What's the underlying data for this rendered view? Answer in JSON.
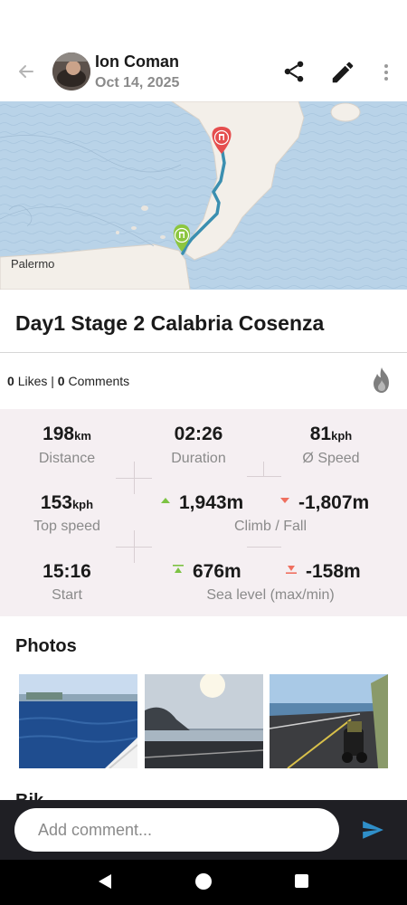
{
  "header": {
    "user_name": "Ion Coman",
    "date": "Oct 14, 2025"
  },
  "map": {
    "city_label": "Palermo"
  },
  "trip": {
    "title": "Day1 Stage 2 Calabria Cosenza"
  },
  "social": {
    "likes_count": "0",
    "likes_label": "Likes |",
    "comments_count": "0",
    "comments_label": "Comments"
  },
  "stats": {
    "distance": {
      "value": "198",
      "unit": "km",
      "label": "Distance"
    },
    "duration": {
      "value": "02:26",
      "label": "Duration"
    },
    "avg_speed": {
      "value": "81",
      "unit": "kph",
      "label": "Ø Speed"
    },
    "top_speed": {
      "value": "153",
      "unit": "kph",
      "label": "Top speed"
    },
    "climb": "1,943m",
    "fall": "-1,807m",
    "climb_fall_label": "Climb / Fall",
    "start": {
      "value": "15:16",
      "label": "Start"
    },
    "sea_max": "676m",
    "sea_min": "-158m",
    "sea_label": "Sea level (max/min)"
  },
  "photos": {
    "title": "Photos"
  },
  "next_section_peek": "Bik",
  "comment": {
    "placeholder": "Add comment..."
  },
  "colors": {
    "accent": "#2f8fc9",
    "route": "#3b8fb0",
    "climb": "#7cc243",
    "fall": "#ef6f5f",
    "stats_bg": "#f5eff2"
  }
}
